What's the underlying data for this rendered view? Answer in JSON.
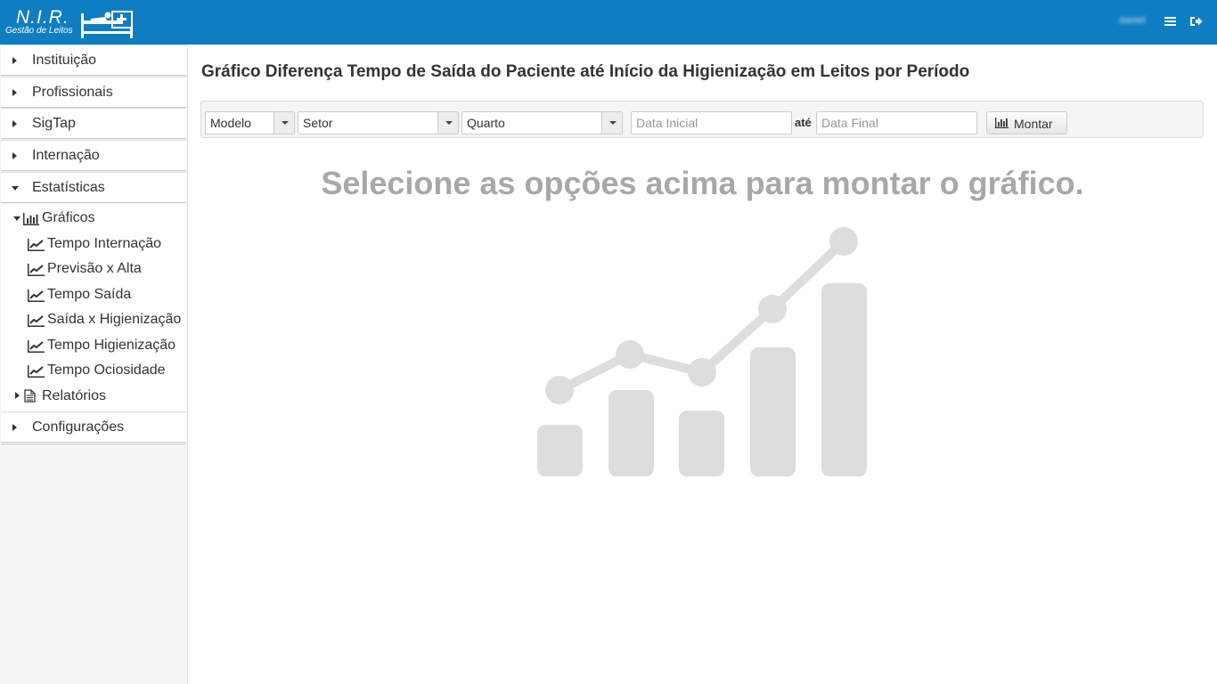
{
  "app": {
    "logo_title": "N.I.R.",
    "logo_subtitle": "Gestão de Leitos",
    "user_name": "daniel"
  },
  "sidebar": {
    "items": [
      {
        "label": "Instituição"
      },
      {
        "label": "Profissionais"
      },
      {
        "label": "SigTap"
      },
      {
        "label": "Internação"
      },
      {
        "label": "Estatísticas"
      },
      {
        "label": "Configurações"
      }
    ],
    "graficos_label": "Gráficos",
    "graficos_children": [
      {
        "label": "Tempo Internação"
      },
      {
        "label": "Previsão x Alta"
      },
      {
        "label": "Tempo Saída"
      },
      {
        "label": "Saída x Higienização"
      },
      {
        "label": "Tempo Higienização"
      },
      {
        "label": "Tempo Ociosidade"
      }
    ],
    "relatorios_label": "Relatórios"
  },
  "main": {
    "title": "Gráfico Diferença Tempo de Saída do Paciente até Início da Higienização em Leitos por Período",
    "filters": {
      "modelo": "Modelo",
      "setor": "Setor",
      "quarto": "Quarto",
      "data_inicial_placeholder": "Data Inicial",
      "ate_label": "até",
      "data_final_placeholder": "Data Final",
      "montar_label": "Montar"
    },
    "empty_message": "Selecione as opções acima para montar o gráfico."
  },
  "colors": {
    "topbar": "#0f7dc2",
    "placeholder_gray": "#a8a8a8",
    "chart_gray": "#dddddd"
  }
}
